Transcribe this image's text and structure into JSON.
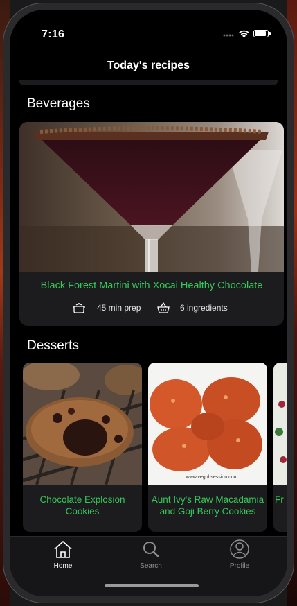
{
  "status_bar": {
    "time": "7:16"
  },
  "nav": {
    "title": "Today's recipes"
  },
  "sections": {
    "beverages": {
      "title": "Beverages",
      "card": {
        "title": "Black Forest Martini with Xocai Healthy Chocolate",
        "prep": "45 min prep",
        "ingredients": "6 ingredients",
        "prep_icon": "cooking-pot-icon",
        "ingredients_icon": "grocery-basket-icon"
      }
    },
    "desserts": {
      "title": "Desserts",
      "cards": [
        {
          "title": "Chocolate Explosion Cookies"
        },
        {
          "title": "Aunt Ivy's Raw Macadamia and Goji Berry Cookies",
          "watermark": "www.vegobsession.com"
        },
        {
          "title": "Fr"
        }
      ]
    }
  },
  "tab_bar": {
    "items": [
      {
        "label": "Home",
        "icon": "house-icon",
        "active": true
      },
      {
        "label": "Search",
        "icon": "magnifier-icon",
        "active": false
      },
      {
        "label": "Profile",
        "icon": "person-circle-icon",
        "active": false
      }
    ]
  },
  "colors": {
    "accent": "#34c759",
    "background": "#000000",
    "card": "#1c1c1e"
  }
}
